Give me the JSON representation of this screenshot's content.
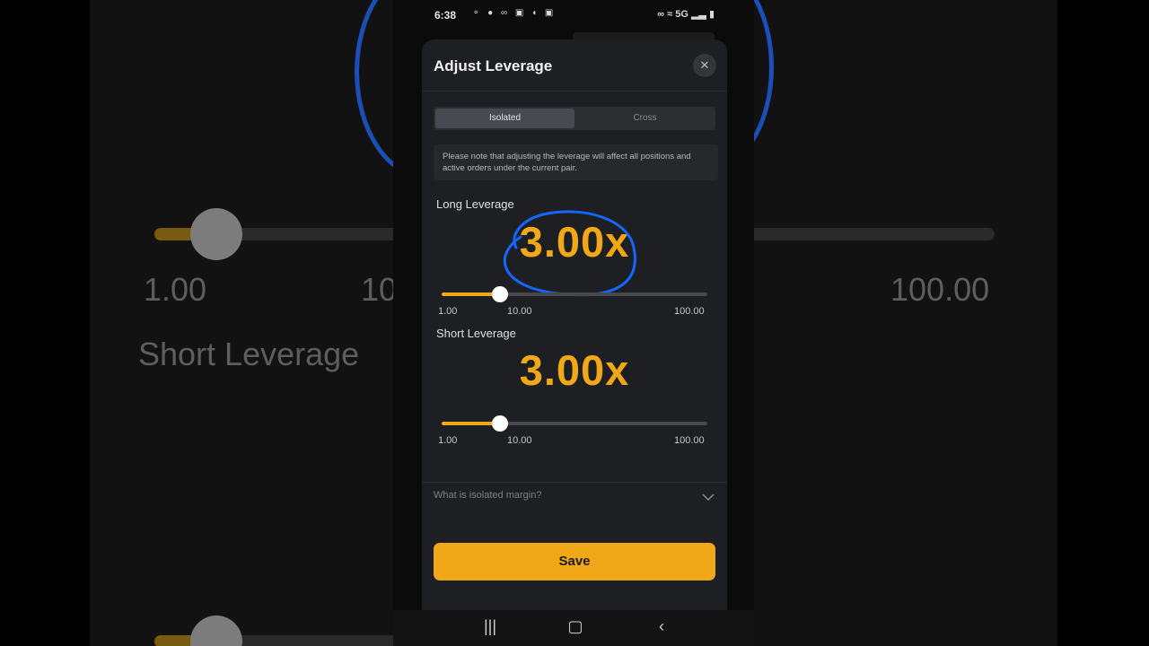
{
  "status_bar": {
    "time": "6:38",
    "network": "5G"
  },
  "sheet": {
    "title": "Adjust Leverage",
    "close_icon": "close-icon"
  },
  "margin_mode": {
    "tabs": [
      {
        "label": "Isolated",
        "active": true
      },
      {
        "label": "Cross",
        "active": false
      }
    ]
  },
  "notice": "Please note that adjusting the leverage will affect all positions and active orders under the current pair.",
  "long_leverage": {
    "label": "Long Leverage",
    "value_text": "3.00x",
    "value": 3.0,
    "min": 1.0,
    "max": 100.0,
    "ticks": [
      "1.00",
      "10.00",
      "100.00"
    ]
  },
  "short_leverage": {
    "label": "Short Leverage",
    "value_text": "3.00x",
    "value": 3.0,
    "min": 1.0,
    "max": 100.0,
    "ticks": [
      "1.00",
      "10.00",
      "100.00"
    ]
  },
  "faq": {
    "label": "What is isolated margin?"
  },
  "save_label": "Save",
  "background": {
    "tick_min": "1.00",
    "tick_mid_partial": "10",
    "tick_max": "100.00",
    "short_label_partial": "Short Leverage"
  },
  "colors": {
    "accent": "#f0a818",
    "sheet": "#1e1f22",
    "annotation": "#1565ff"
  }
}
